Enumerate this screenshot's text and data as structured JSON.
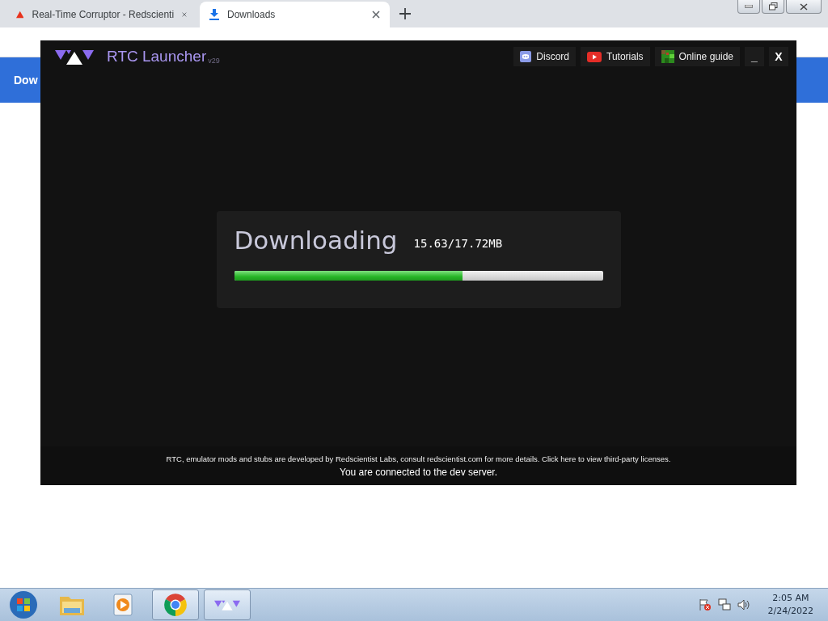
{
  "browser": {
    "tabs": [
      {
        "title": "Real-Time Corruptor - Redscienti",
        "kind": "warning",
        "selected": false
      },
      {
        "title": "Downloads",
        "kind": "download",
        "selected": true
      }
    ],
    "page_header": "Dow"
  },
  "launcher": {
    "title": "RTC Launcher",
    "version": "v29",
    "links": [
      {
        "label": "Discord",
        "kind": "discord"
      },
      {
        "label": "Tutorials",
        "kind": "youtube"
      },
      {
        "label": "Online guide",
        "kind": "guide"
      }
    ],
    "minimize": "_",
    "close": "X",
    "download": {
      "heading": "Downloading",
      "size": "15.63/17.72MB",
      "level": 0.62
    },
    "footer": {
      "notice": "RTC, emulator mods and stubs are developed by Redscientist Labs, consult redscientist.com for more details. Click here to view third-party licenses.",
      "status": "You are connected to the dev server."
    }
  },
  "taskbar": {
    "apps": [
      {
        "kind": "start",
        "active": false
      },
      {
        "kind": "folder",
        "active": false
      },
      {
        "kind": "media",
        "active": false
      },
      {
        "kind": "chrome",
        "active": true
      },
      {
        "kind": "rtc",
        "active": true
      }
    ],
    "clock": {
      "time": "2:05 AM",
      "date": "2/24/2022"
    }
  }
}
